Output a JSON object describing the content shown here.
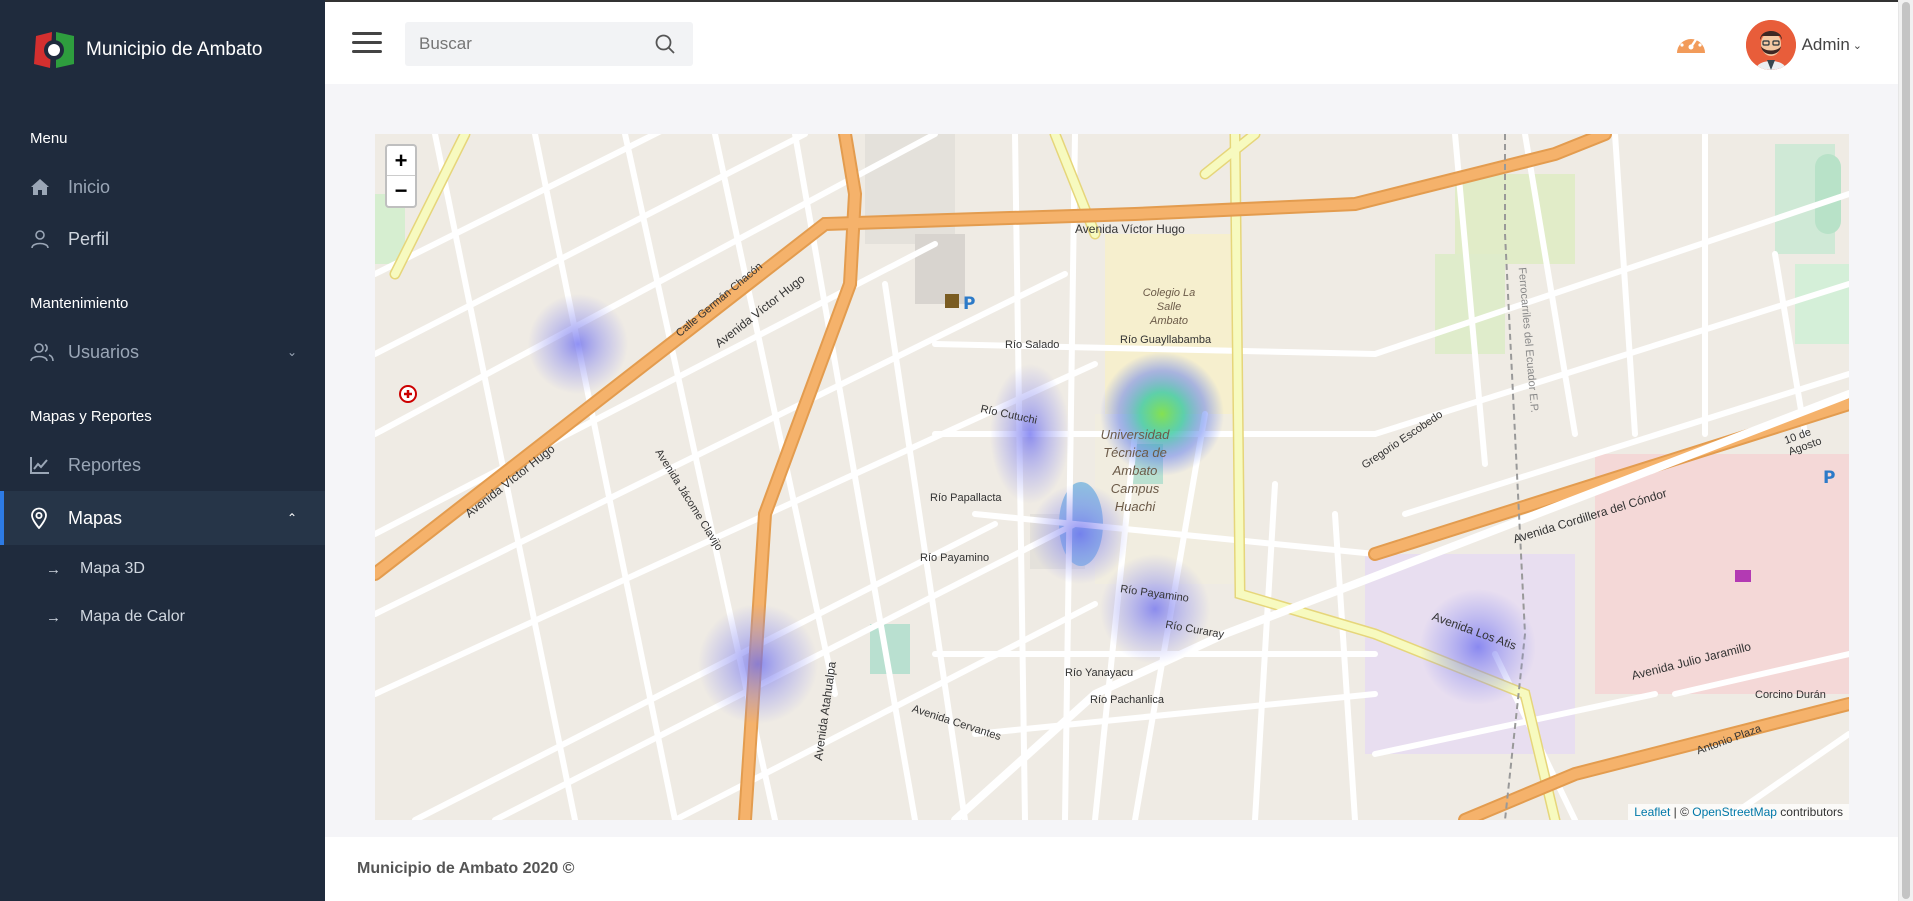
{
  "brand": {
    "name": "Municipio de Ambato"
  },
  "sidebar": {
    "sections": [
      {
        "title": "Menu"
      },
      {
        "title": "Mantenimiento"
      },
      {
        "title": "Mapas y Reportes"
      }
    ],
    "items": {
      "inicio": "Inicio",
      "perfil": "Perfil",
      "usuarios": "Usuarios",
      "reportes": "Reportes",
      "mapas": "Mapas"
    },
    "subitems": [
      "Mapa 3D",
      "Mapa de Calor"
    ]
  },
  "header": {
    "search_placeholder": "Buscar",
    "user_name": "Admin"
  },
  "map": {
    "zoom_in": "+",
    "zoom_out": "−",
    "attribution": {
      "leaflet": "Leaflet",
      "sep": " | © ",
      "osm": "OpenStreetMap",
      "contributors": " contributors"
    },
    "labels": [
      "Avenida Víctor Hugo",
      "Avenida Víctor Hugo",
      "Avenida Víctor Hugo",
      "Avenida Atahualpa",
      "Avenida Los Atis",
      "Avenida Julio Jaramillo",
      "Avenida Cordillera del Cóndor",
      "Universidad Técnica de Ambato Campus Huachi",
      "Colegio La Salle Ambato",
      "Río Guayllabamba",
      "Río Salado",
      "Río Cutuchi",
      "Río Papallacta",
      "Río Payamino",
      "Río Payamino",
      "Río Curaray",
      "Río Pachanlica",
      "Avenida Cervantes",
      "Río Yanayacu",
      "Avenida Jácome Clavijo",
      "Calle Germán Chacón",
      "Gregorio Escobedo",
      "Corcino Durán",
      "Antonio Plaza",
      "Ferrocarriles del Ecuador E.P.",
      "10 de Agosto"
    ]
  },
  "footer": {
    "text": "Municipio de Ambato 2020 ©"
  },
  "colors": {
    "sidebar": "#1f2b3d",
    "accent": "#2d7be5",
    "road_primary": "#f5b26b",
    "road_secondary": "#f7fabf"
  }
}
